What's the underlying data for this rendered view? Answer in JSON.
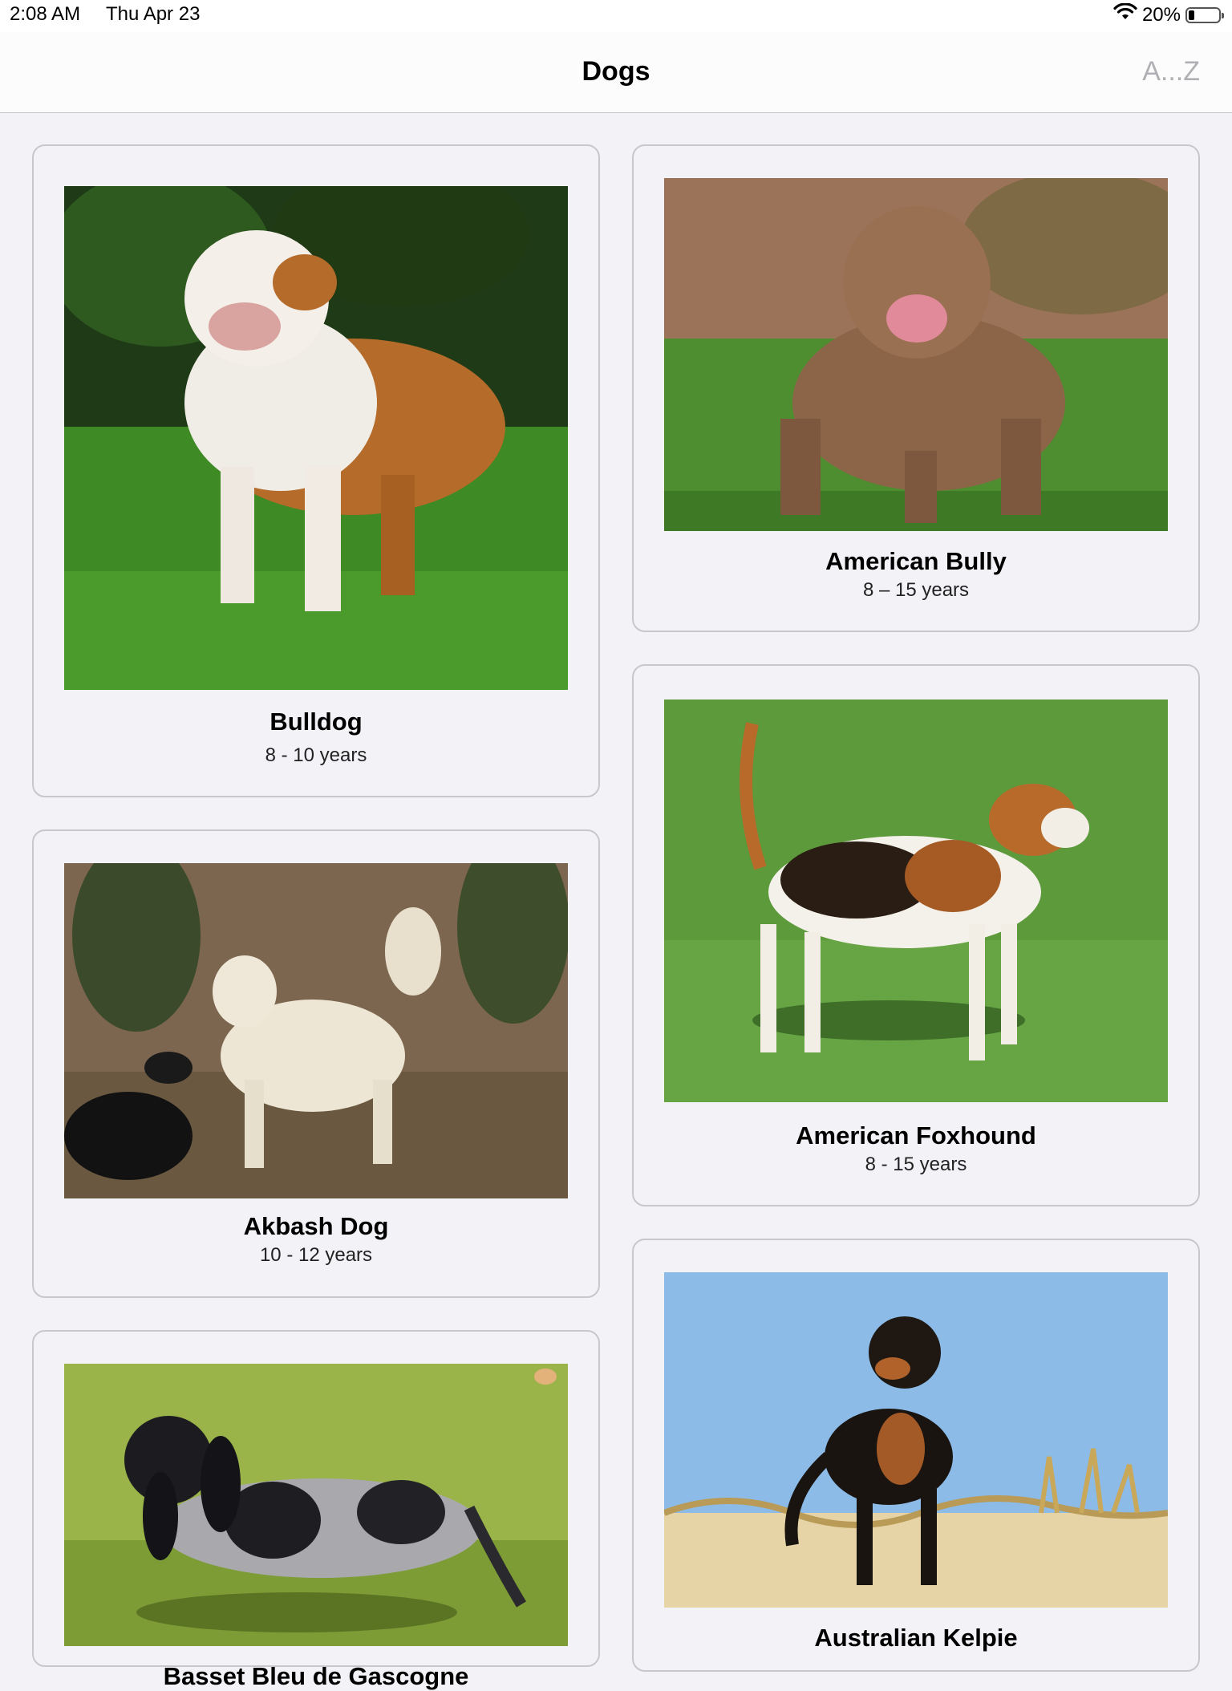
{
  "status_bar": {
    "time": "2:08 AM",
    "date": "Thu Apr 23",
    "battery_label": "20%",
    "battery_level": 0.2
  },
  "nav": {
    "title": "Dogs",
    "sort_label": "A...Z"
  },
  "breeds": [
    {
      "name": "Bulldog",
      "life_span": "8 - 10 years"
    },
    {
      "name": "American Bully",
      "life_span": "8 – 15 years"
    },
    {
      "name": "Akbash Dog",
      "life_span": "10 - 12 years"
    },
    {
      "name": "American Foxhound",
      "life_span": "8 - 15 years"
    },
    {
      "name": "Basset Bleu de Gascogne",
      "life_span": ""
    },
    {
      "name": "Australian Kelpie",
      "life_span": ""
    }
  ]
}
